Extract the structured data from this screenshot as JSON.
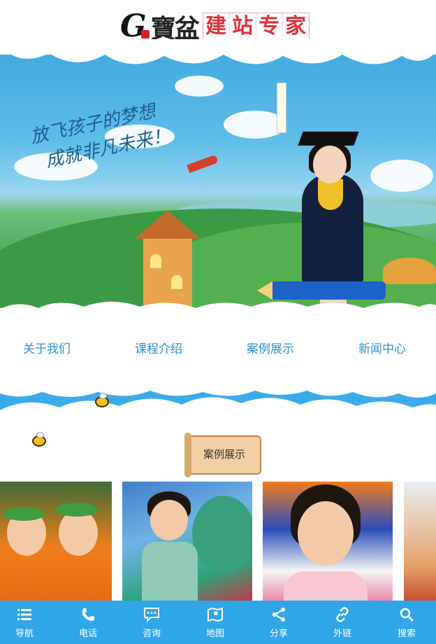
{
  "header": {
    "logo_letter": "G",
    "logo_brand": "寶盆",
    "logo_tagline": [
      "建",
      "站",
      "专",
      "家"
    ]
  },
  "banner": {
    "slogan_line1": "放飞孩子的梦想",
    "slogan_line2": "成就非凡未来！"
  },
  "nav": {
    "items": [
      {
        "label": "关于我们"
      },
      {
        "label": "课程介绍"
      },
      {
        "label": "案例展示"
      },
      {
        "label": "新闻中心"
      }
    ]
  },
  "cases": {
    "title": "案例展示"
  },
  "bottom_bar": {
    "items": [
      {
        "label": "导航",
        "icon": "menu-icon"
      },
      {
        "label": "电话",
        "icon": "phone-icon"
      },
      {
        "label": "咨询",
        "icon": "chat-icon"
      },
      {
        "label": "地图",
        "icon": "map-icon"
      },
      {
        "label": "分享",
        "icon": "share-icon"
      },
      {
        "label": "外链",
        "icon": "link-icon"
      },
      {
        "label": "搜索",
        "icon": "search-icon"
      }
    ]
  },
  "colors": {
    "primary": "#2fa6e8",
    "nav_text": "#2c8fd0",
    "logo_red": "#e0313b"
  }
}
